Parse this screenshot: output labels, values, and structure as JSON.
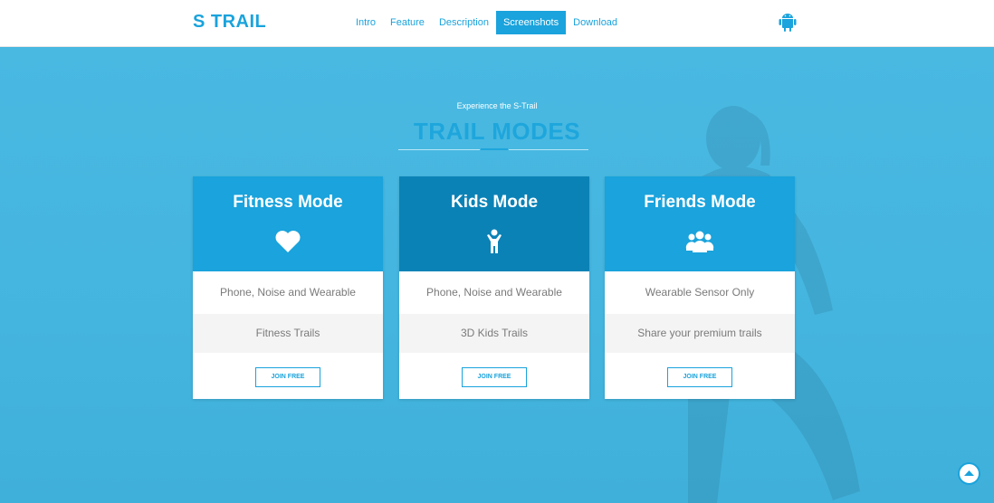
{
  "brand": "S TRAIL",
  "nav": [
    "Intro",
    "Feature",
    "Description",
    "Screenshots",
    "Download"
  ],
  "active_nav": "Screenshots",
  "hero": {
    "kicker": "Experience the S-Trail",
    "title": "TRAIL MODES"
  },
  "cards": [
    {
      "title": "Fitness Mode",
      "icon": "heart-icon",
      "feature1": "Phone, Noise and Wearable",
      "feature2": "Fitness Trails",
      "button": "JOIN FREE"
    },
    {
      "title": "Kids Mode",
      "icon": "child-icon",
      "feature1": "Phone, Noise and Wearable",
      "feature2": "3D Kids Trails",
      "button": "JOIN FREE"
    },
    {
      "title": "Friends Mode",
      "icon": "users-icon",
      "feature1": "Wearable Sensor Only",
      "feature2": "Share your premium trails",
      "button": "JOIN FREE"
    }
  ],
  "colors": {
    "accent": "#1aa3dc",
    "kids_header": "#0b82b6",
    "hero_bg": "#45b6e0"
  }
}
